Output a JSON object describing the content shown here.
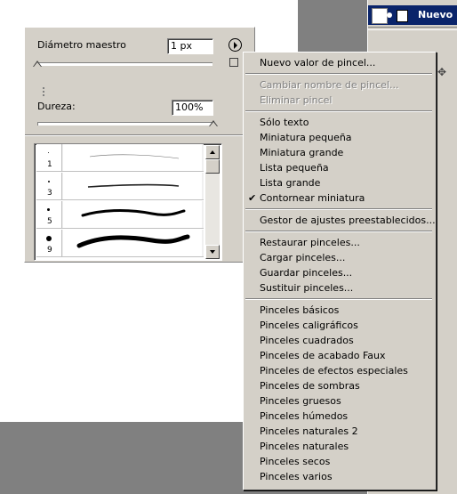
{
  "layers_panel": {
    "layer_name": "Nuevo"
  },
  "brush_panel": {
    "diameter_label": "Diámetro maestro",
    "diameter_value": "1 px",
    "diameter_fraction": 0.0,
    "hardness_label": "Dureza:",
    "hardness_value": "100%",
    "hardness_fraction": 1.0,
    "brushes": [
      {
        "size": "1"
      },
      {
        "size": "3"
      },
      {
        "size": "5"
      },
      {
        "size": "9"
      }
    ]
  },
  "menu": {
    "items": [
      {
        "label": "Nuevo valor de pincel...",
        "enabled": true
      },
      {
        "sep": true
      },
      {
        "label": "Cambiar nombre de pincel...",
        "enabled": false
      },
      {
        "label": "Eliminar pincel",
        "enabled": false
      },
      {
        "sep": true
      },
      {
        "label": "Sólo texto",
        "enabled": true
      },
      {
        "label": "Miniatura pequeña",
        "enabled": true
      },
      {
        "label": "Miniatura grande",
        "enabled": true
      },
      {
        "label": "Lista pequeña",
        "enabled": true
      },
      {
        "label": "Lista grande",
        "enabled": true
      },
      {
        "label": "Contornear miniatura",
        "enabled": true,
        "checked": true
      },
      {
        "sep": true
      },
      {
        "label": "Gestor de ajustes preestablecidos...",
        "enabled": true
      },
      {
        "sep": true
      },
      {
        "label": "Restaurar pinceles...",
        "enabled": true
      },
      {
        "label": "Cargar pinceles...",
        "enabled": true
      },
      {
        "label": "Guardar pinceles...",
        "enabled": true
      },
      {
        "label": "Sustituir pinceles...",
        "enabled": true
      },
      {
        "sep": true
      },
      {
        "label": "Pinceles básicos",
        "enabled": true
      },
      {
        "label": "Pinceles caligráficos",
        "enabled": true
      },
      {
        "label": "Pinceles cuadrados",
        "enabled": true
      },
      {
        "label": "Pinceles de acabado Faux",
        "enabled": true
      },
      {
        "label": "Pinceles de efectos especiales",
        "enabled": true
      },
      {
        "label": "Pinceles de sombras",
        "enabled": true
      },
      {
        "label": "Pinceles gruesos",
        "enabled": true
      },
      {
        "label": "Pinceles húmedos",
        "enabled": true
      },
      {
        "label": "Pinceles naturales 2",
        "enabled": true
      },
      {
        "label": "Pinceles naturales",
        "enabled": true
      },
      {
        "label": "Pinceles secos",
        "enabled": true
      },
      {
        "label": "Pinceles varios",
        "enabled": true
      }
    ],
    "check_glyph": "✔"
  }
}
